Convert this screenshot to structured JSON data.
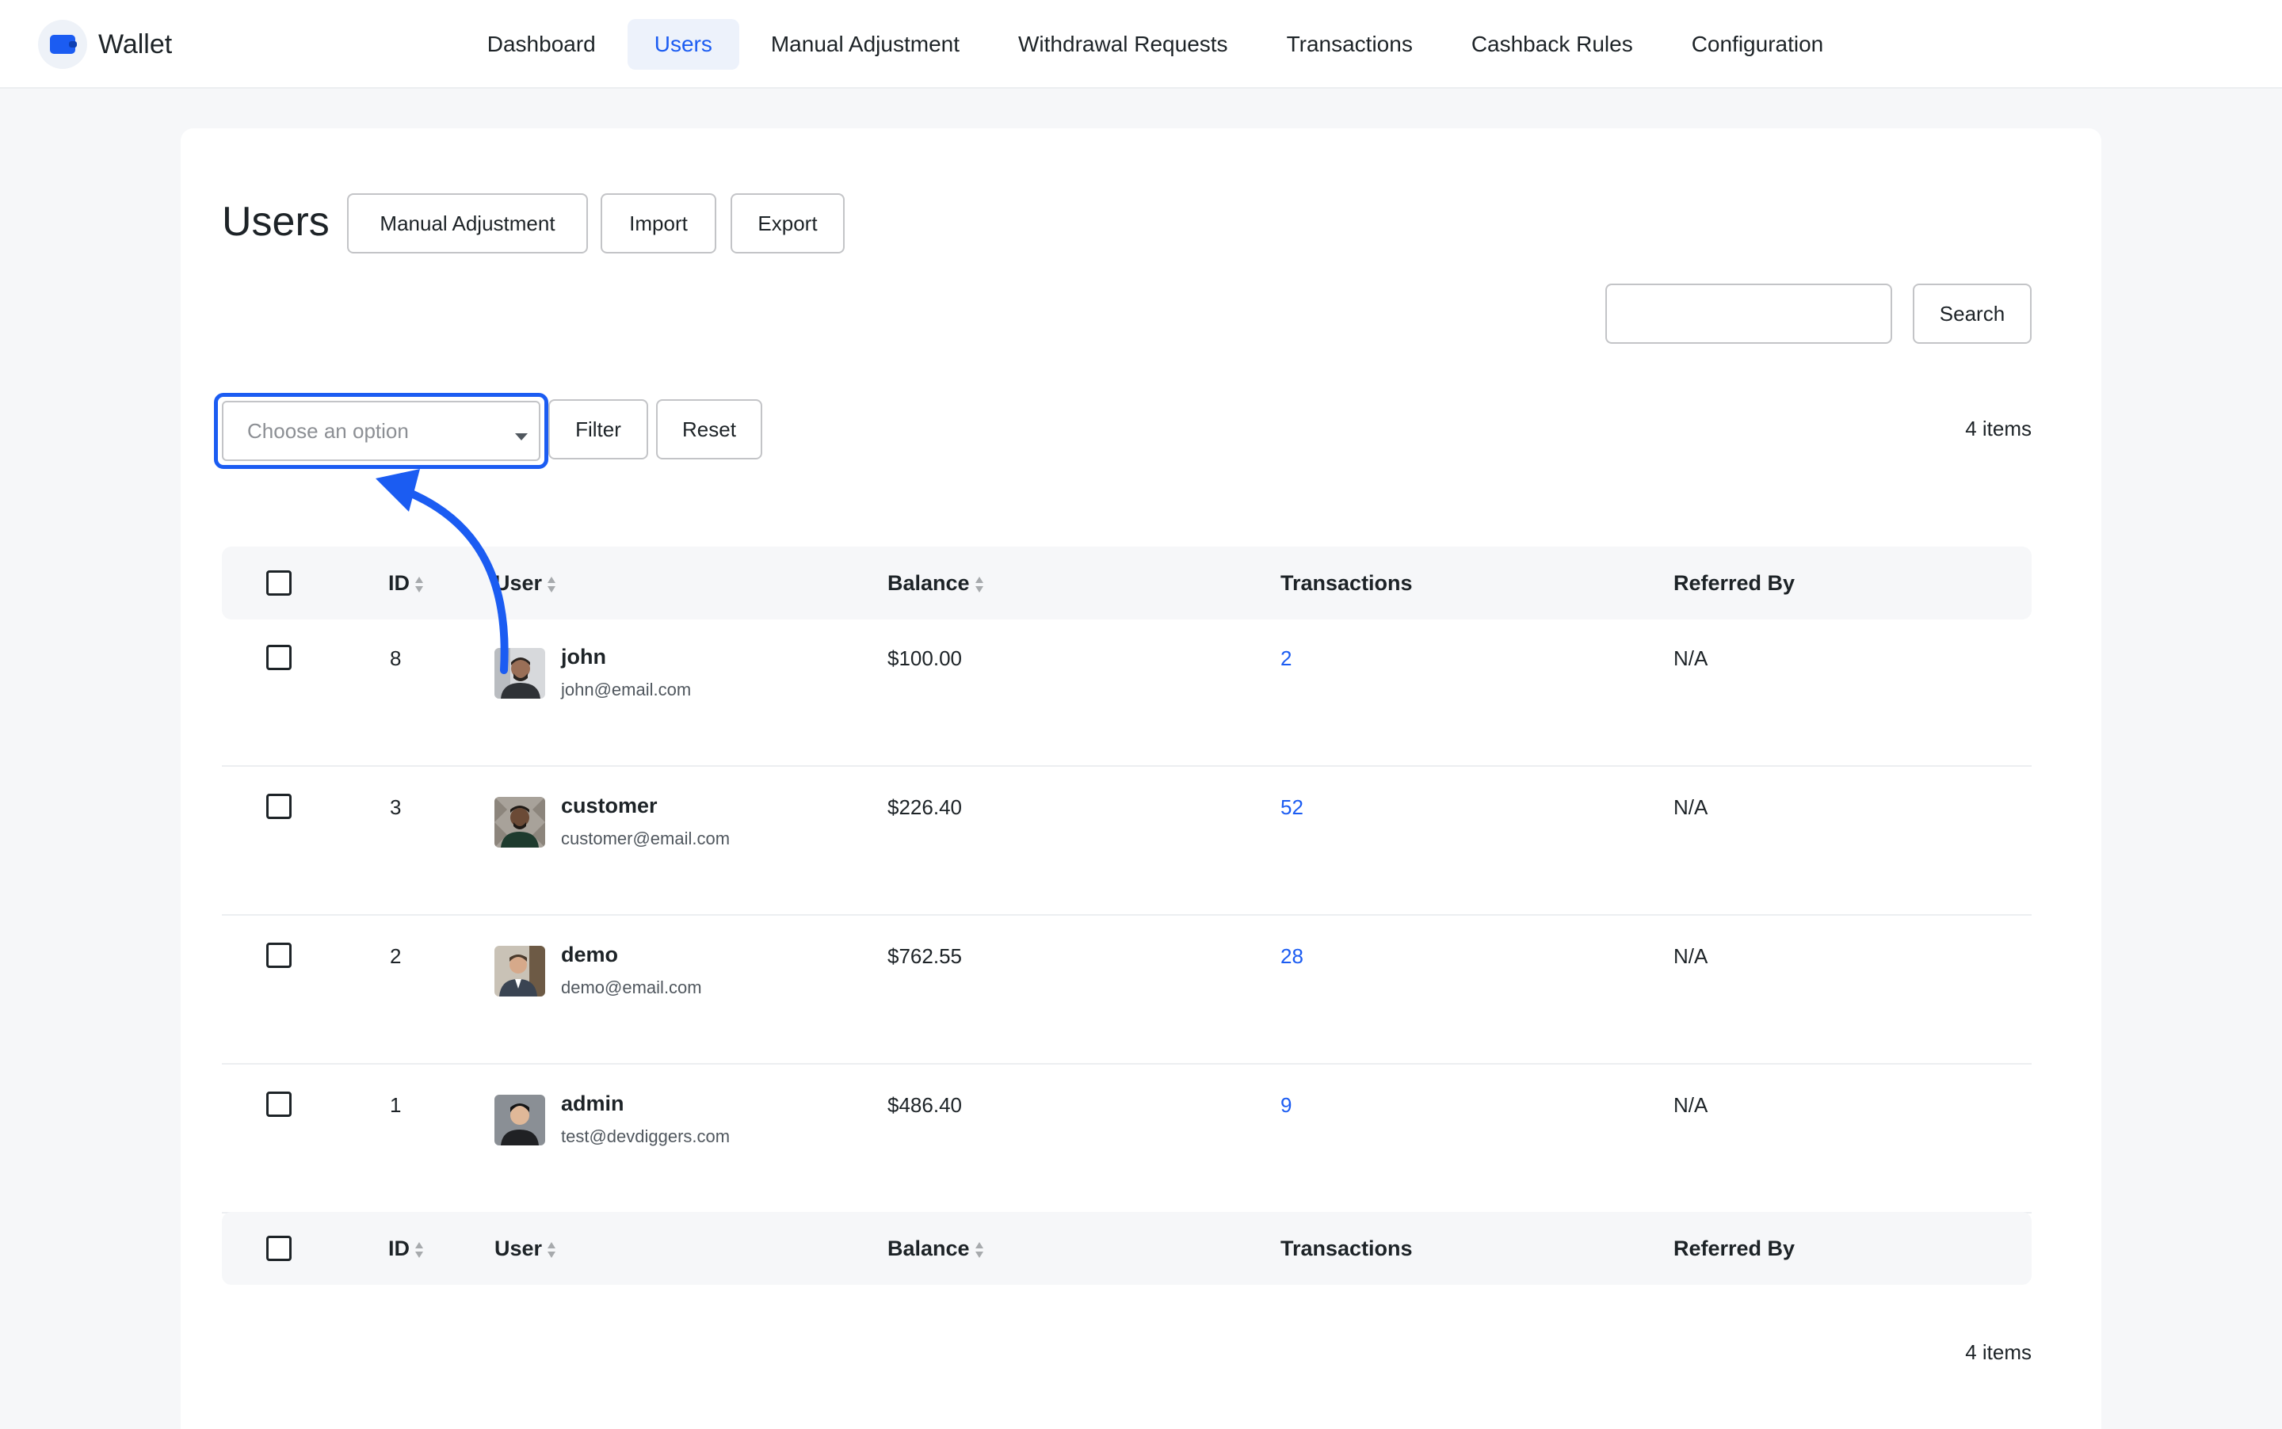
{
  "app": {
    "name": "Wallet"
  },
  "nav": {
    "items": [
      {
        "label": "Dashboard",
        "active": false
      },
      {
        "label": "Users",
        "active": true
      },
      {
        "label": "Manual Adjustment",
        "active": false
      },
      {
        "label": "Withdrawal Requests",
        "active": false
      },
      {
        "label": "Transactions",
        "active": false
      },
      {
        "label": "Cashback Rules",
        "active": false
      },
      {
        "label": "Configuration",
        "active": false
      }
    ]
  },
  "page": {
    "title": "Users",
    "actions": {
      "manual_adjustment": "Manual Adjustment",
      "import": "Import",
      "export": "Export"
    },
    "search": {
      "value": "",
      "button": "Search"
    },
    "filter": {
      "placeholder": "Choose an option",
      "filter_button": "Filter",
      "reset_button": "Reset"
    },
    "item_count": "4 items"
  },
  "table": {
    "columns": {
      "id": "ID",
      "user": "User",
      "balance": "Balance",
      "transactions": "Transactions",
      "referred_by": "Referred By"
    },
    "rows": [
      {
        "id": "8",
        "name": "john",
        "email": "john@email.com",
        "balance": "$100.00",
        "transactions": "2",
        "referred_by": "N/A"
      },
      {
        "id": "3",
        "name": "customer",
        "email": "customer@email.com",
        "balance": "$226.40",
        "transactions": "52",
        "referred_by": "N/A"
      },
      {
        "id": "2",
        "name": "demo",
        "email": "demo@email.com",
        "balance": "$762.55",
        "transactions": "28",
        "referred_by": "N/A"
      },
      {
        "id": "1",
        "name": "admin",
        "email": "test@devdiggers.com",
        "balance": "$486.40",
        "transactions": "9",
        "referred_by": "N/A"
      }
    ]
  },
  "colors": {
    "accent": "#1b5cf2",
    "border": "#c3c4c7",
    "text": "#1d2327"
  }
}
